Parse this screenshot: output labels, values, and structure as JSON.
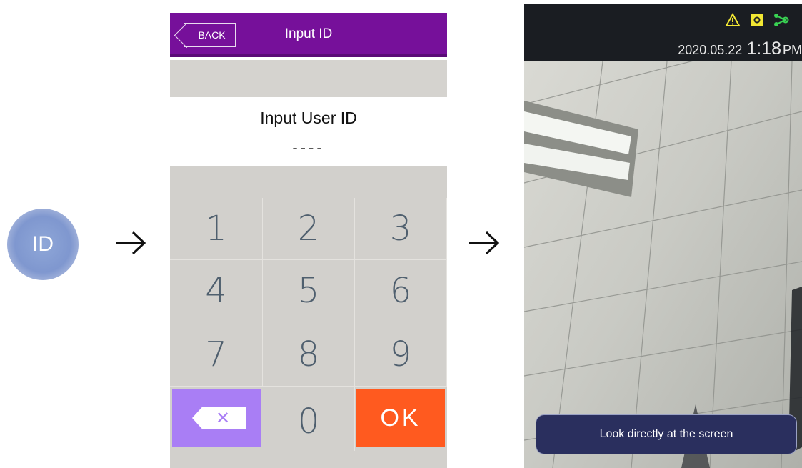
{
  "step1": {
    "badge_label": "ID"
  },
  "arrows": [
    "arrow-right-icon",
    "arrow-right-icon"
  ],
  "keypad_screen": {
    "back_label": "BACK",
    "title": "Input ID",
    "prompt": "Input User ID",
    "id_value": "----",
    "keys": [
      "1",
      "2",
      "3",
      "4",
      "5",
      "6",
      "7",
      "8",
      "9",
      "0"
    ],
    "delete_icon": "backspace-icon",
    "ok_label": "OK",
    "colors": {
      "header": "#76109a",
      "delete_key": "#a97ef5",
      "ok_key": "#ff5a1f",
      "keypad_bg": "#d2d0cc"
    }
  },
  "camera_screen": {
    "status_icons": [
      "warning-icon",
      "door-icon",
      "network-icon"
    ],
    "status_colors": {
      "warning": "#f2e733",
      "door": "#f2e733",
      "network": "#39d353"
    },
    "date": "2020.05.22",
    "time": "1:18",
    "ampm": "PM",
    "message": "Look directly at the screen"
  }
}
